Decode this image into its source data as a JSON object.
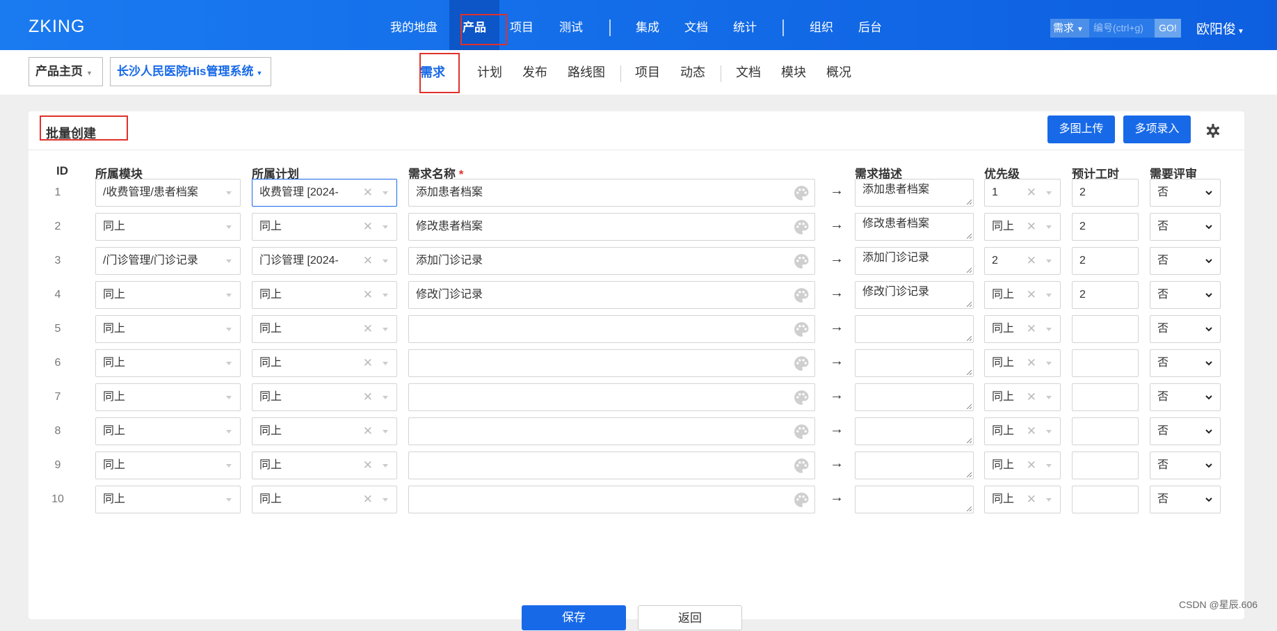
{
  "app": {
    "logo": "ZKING",
    "user": "欧阳俊"
  },
  "topnav": [
    {
      "label": "我的地盘"
    },
    {
      "label": "产品"
    },
    {
      "label": "项目"
    },
    {
      "label": "测试"
    },
    {
      "label": "集成"
    },
    {
      "label": "文档"
    },
    {
      "label": "统计"
    },
    {
      "label": "组织"
    },
    {
      "label": "后台"
    }
  ],
  "search": {
    "type": "需求",
    "placeholder": "编号(ctrl+g)",
    "go": "GO!"
  },
  "breadcrumb": {
    "home": "产品主页",
    "product": "长沙人民医院His管理系统"
  },
  "subnav": [
    {
      "label": "需求"
    },
    {
      "label": "计划"
    },
    {
      "label": "发布"
    },
    {
      "label": "路线图"
    },
    {
      "label": "项目"
    },
    {
      "label": "动态"
    },
    {
      "label": "文档"
    },
    {
      "label": "模块"
    },
    {
      "label": "概况"
    }
  ],
  "panel": {
    "title": "批量创建",
    "upload_btn": "多图上传",
    "multi_btn": "多项录入"
  },
  "columns": {
    "id": "ID",
    "module": "所属模块",
    "plan": "所属计划",
    "name": "需求名称",
    "required": "*",
    "desc": "需求描述",
    "priority": "优先级",
    "estimate": "预计工时",
    "review": "需要评审"
  },
  "rows": [
    {
      "id": "1",
      "module": "/收费管理/患者档案",
      "plan": "收费管理 [2024-",
      "name": "添加患者档案",
      "desc": "添加患者档案",
      "priority": "1",
      "estimate": "2",
      "review": "否"
    },
    {
      "id": "2",
      "module": "同上",
      "plan": "同上",
      "name": "修改患者档案",
      "desc": "修改患者档案",
      "priority": "同上",
      "estimate": "2",
      "review": "否"
    },
    {
      "id": "3",
      "module": "/门诊管理/门诊记录",
      "plan": "门诊管理 [2024-",
      "name": "添加门诊记录",
      "desc": "添加门诊记录",
      "priority": "2",
      "estimate": "2",
      "review": "否"
    },
    {
      "id": "4",
      "module": "同上",
      "plan": "同上",
      "name": "修改门诊记录",
      "desc": "修改门诊记录",
      "priority": "同上",
      "estimate": "2",
      "review": "否"
    },
    {
      "id": "5",
      "module": "同上",
      "plan": "同上",
      "name": "",
      "desc": "",
      "priority": "同上",
      "estimate": "",
      "review": "否"
    },
    {
      "id": "6",
      "module": "同上",
      "plan": "同上",
      "name": "",
      "desc": "",
      "priority": "同上",
      "estimate": "",
      "review": "否"
    },
    {
      "id": "7",
      "module": "同上",
      "plan": "同上",
      "name": "",
      "desc": "",
      "priority": "同上",
      "estimate": "",
      "review": "否"
    },
    {
      "id": "8",
      "module": "同上",
      "plan": "同上",
      "name": "",
      "desc": "",
      "priority": "同上",
      "estimate": "",
      "review": "否"
    },
    {
      "id": "9",
      "module": "同上",
      "plan": "同上",
      "name": "",
      "desc": "",
      "priority": "同上",
      "estimate": "",
      "review": "否"
    },
    {
      "id": "10",
      "module": "同上",
      "plan": "同上",
      "name": "",
      "desc": "",
      "priority": "同上",
      "estimate": "",
      "review": "否"
    }
  ],
  "footer": {
    "save": "保存",
    "back": "返回"
  },
  "watermark": "CSDN @星辰.606",
  "colors": {
    "primary": "#1769e8",
    "highlight": "#e0312a"
  }
}
